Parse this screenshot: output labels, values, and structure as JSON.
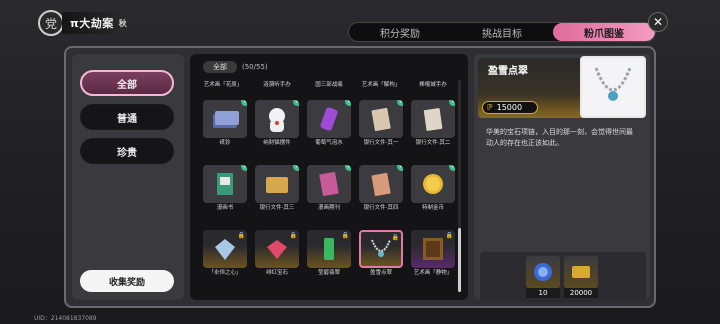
{
  "header": {
    "logo_glyph": "党",
    "title": "π大劫案",
    "title_badge": "秋",
    "tabs": [
      {
        "label": "积分奖励",
        "active": false
      },
      {
        "label": "挑战目标",
        "active": false
      },
      {
        "label": "粉爪图鉴",
        "active": true
      }
    ],
    "close_glyph": "✕"
  },
  "categories": [
    {
      "label": "全部",
      "active": true
    },
    {
      "label": "普通",
      "active": false
    },
    {
      "label": "珍贵",
      "active": false
    }
  ],
  "collect_reward_label": "收集奖励",
  "grid": {
    "filter_label": "全部",
    "count_text": "(50/55)",
    "top_row_names": [
      "艺术画「花原」",
      "涟漪听手办",
      "国三部战痛",
      "艺术画「解构」",
      "棒棍城手办"
    ],
    "items": [
      {
        "name": "纸钞",
        "collected": true,
        "locked": false,
        "rarity": "normal",
        "icon": "banknotes-icon"
      },
      {
        "name": "纳财猫摆件",
        "collected": true,
        "locked": false,
        "rarity": "normal",
        "icon": "lucky-cat-icon"
      },
      {
        "name": "葡萄气泡水",
        "collected": true,
        "locked": false,
        "rarity": "normal",
        "icon": "soda-can-icon"
      },
      {
        "name": "银行文件·其一",
        "collected": true,
        "locked": false,
        "rarity": "normal",
        "icon": "document-icon"
      },
      {
        "name": "银行文件·其二",
        "collected": true,
        "locked": false,
        "rarity": "normal",
        "icon": "document-icon"
      },
      {
        "name": "漫画书",
        "collected": true,
        "locked": false,
        "rarity": "normal",
        "icon": "comic-book-icon"
      },
      {
        "name": "银行文件·其三",
        "collected": true,
        "locked": false,
        "rarity": "normal",
        "icon": "folder-icon"
      },
      {
        "name": "漫画期刊",
        "collected": true,
        "locked": false,
        "rarity": "normal",
        "icon": "magazine-icon"
      },
      {
        "name": "银行文件·其四",
        "collected": true,
        "locked": false,
        "rarity": "normal",
        "icon": "document-icon"
      },
      {
        "name": "特制金币",
        "collected": true,
        "locked": false,
        "rarity": "normal",
        "icon": "gold-coin-icon"
      },
      {
        "name": "「永恒之心」",
        "collected": false,
        "locked": true,
        "rarity": "gold",
        "icon": "diamond-icon"
      },
      {
        "name": "绯红宝石",
        "collected": false,
        "locked": true,
        "rarity": "gold",
        "icon": "ruby-icon"
      },
      {
        "name": "莹碧翡翠",
        "collected": false,
        "locked": true,
        "rarity": "gold",
        "icon": "emerald-icon"
      },
      {
        "name": "盈雪点翠",
        "collected": false,
        "locked": true,
        "rarity": "gold",
        "icon": "necklace-icon",
        "selected": true
      },
      {
        "name": "艺术画「静物」",
        "collected": false,
        "locked": true,
        "rarity": "purple",
        "icon": "painting-icon"
      }
    ]
  },
  "detail": {
    "name": "盈雪点翠",
    "price": "15000",
    "description": "华美的宝石项链，入目的那一刻，会觉得世间最动人的存在也正该如此。",
    "rewards": [
      {
        "value": "10",
        "icon": "blue-gem-icon"
      },
      {
        "value": "20000",
        "icon": "gold-card-icon"
      }
    ]
  },
  "footer": {
    "uid_text": "UID：214081837089"
  },
  "colors": {
    "accent_pink": "#e47aa8",
    "check_green": "#3fbf8a",
    "gold": "#d8a830"
  }
}
